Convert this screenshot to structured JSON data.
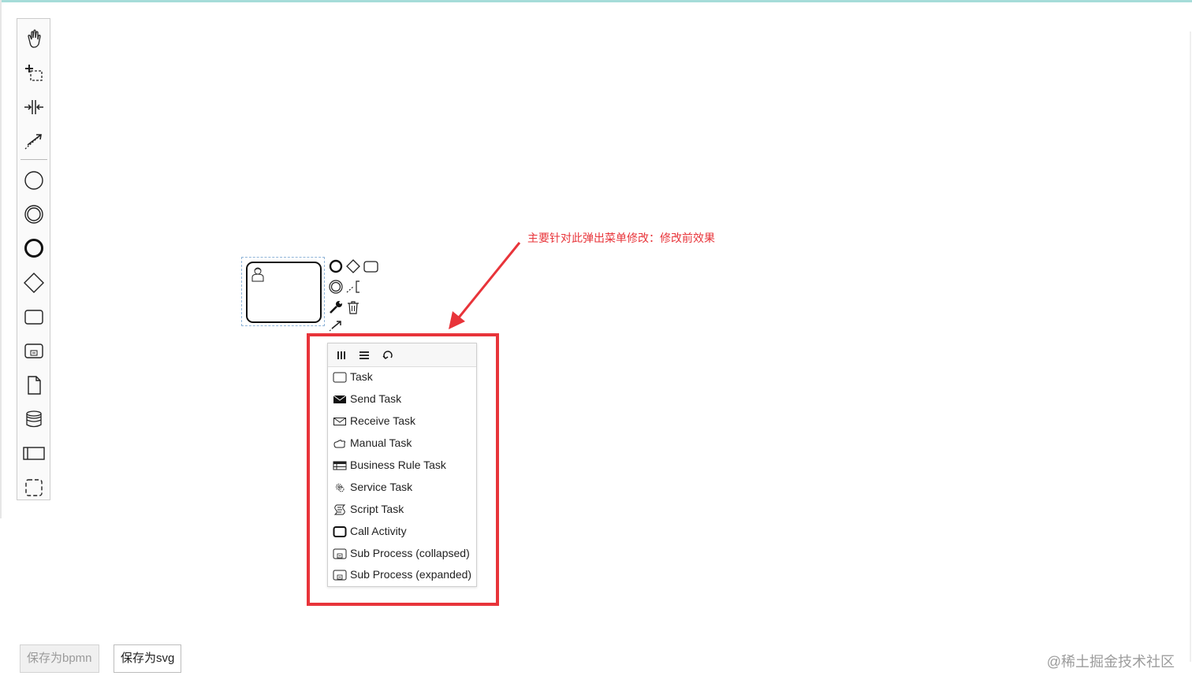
{
  "palette": {
    "tools": [
      {
        "icon": "hand-tool-icon"
      },
      {
        "icon": "lasso-tool-icon"
      },
      {
        "icon": "space-tool-icon"
      },
      {
        "icon": "global-connect-tool-icon"
      }
    ],
    "shapes": [
      {
        "icon": "start-event-icon"
      },
      {
        "icon": "intermediate-event-icon"
      },
      {
        "icon": "end-event-icon"
      },
      {
        "icon": "gateway-icon"
      },
      {
        "icon": "task-icon"
      },
      {
        "icon": "subprocess-icon"
      },
      {
        "icon": "data-object-icon"
      },
      {
        "icon": "data-store-icon"
      },
      {
        "icon": "pool-icon"
      },
      {
        "icon": "group-icon"
      }
    ]
  },
  "canvas": {
    "element": {
      "type": "user-task",
      "icon": "user-icon"
    },
    "context_pad": [
      {
        "icon": "end-event-icon"
      },
      {
        "icon": "gateway-icon"
      },
      {
        "icon": "task-icon"
      },
      {
        "icon": "intermediate-event-icon"
      },
      {
        "icon": "text-annotation-icon"
      },
      {
        "icon": "wrench-icon"
      },
      {
        "icon": "trash-icon"
      },
      {
        "icon": "connect-icon"
      }
    ]
  },
  "annotation": {
    "text": "主要针对此弹出菜单修改：修改前效果",
    "color": "#e8343a"
  },
  "popup_menu": {
    "header_icons": [
      "parallel-multi-instance-icon",
      "sequential-multi-instance-icon",
      "loop-icon"
    ],
    "items": [
      {
        "label": "Task",
        "icon": "task-icon"
      },
      {
        "label": "Send Task",
        "icon": "send-envelope-icon"
      },
      {
        "label": "Receive Task",
        "icon": "receive-envelope-icon"
      },
      {
        "label": "Manual Task",
        "icon": "hand-icon"
      },
      {
        "label": "Business Rule Task",
        "icon": "table-icon"
      },
      {
        "label": "Service Task",
        "icon": "gear-icon"
      },
      {
        "label": "Script Task",
        "icon": "script-icon"
      },
      {
        "label": "Call Activity",
        "icon": "call-activity-icon"
      },
      {
        "label": "Sub Process (collapsed)",
        "icon": "subprocess-collapsed-icon"
      },
      {
        "label": "Sub Process (expanded)",
        "icon": "subprocess-expanded-icon"
      }
    ]
  },
  "buttons": {
    "save_bpmn": "保存为bpmn",
    "save_svg": "保存为svg"
  },
  "watermark": "@稀土掘金技术社区"
}
